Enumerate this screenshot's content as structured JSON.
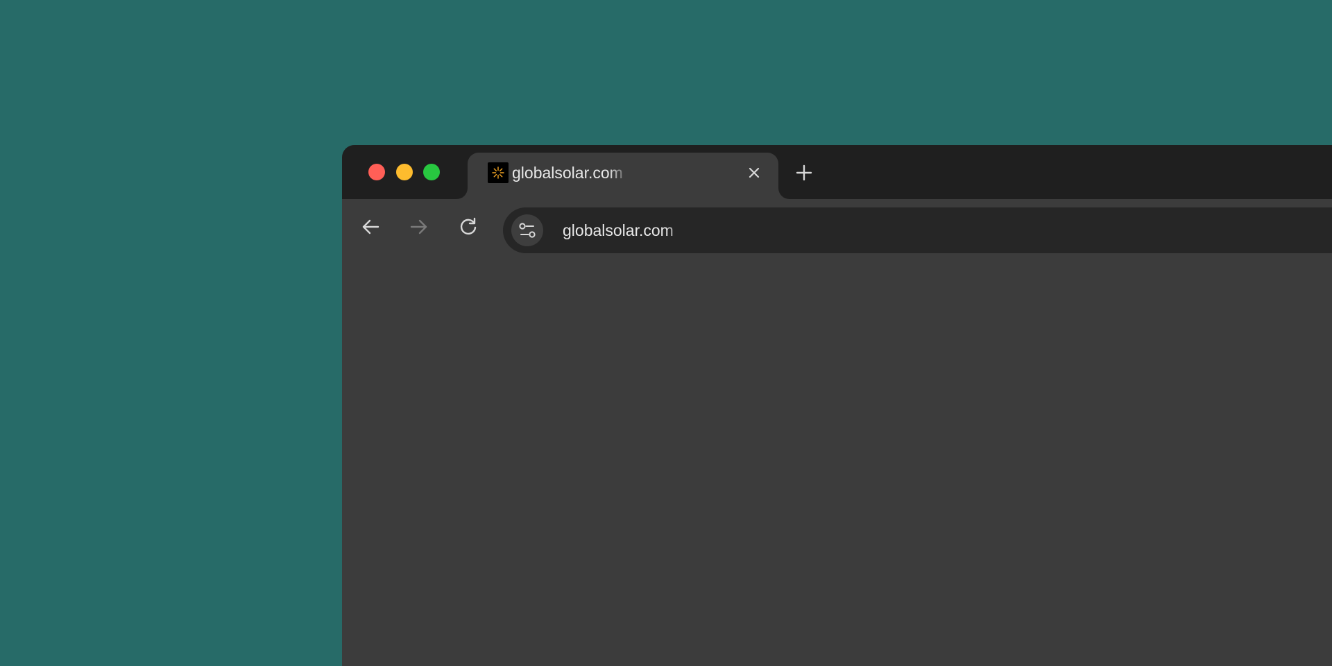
{
  "window": {
    "controls": [
      "close",
      "minimize",
      "maximize"
    ]
  },
  "tabs": [
    {
      "title": "globalsolar.com",
      "favicon": "sun-logo-icon",
      "active": true
    }
  ],
  "toolbar": {
    "back_icon": "arrow-left-icon",
    "forward_icon": "arrow-right-icon",
    "reload_icon": "reload-icon",
    "site_info_icon": "tune-icon"
  },
  "address_bar": {
    "value": "globalsolar.com"
  },
  "colors": {
    "desktop_background": "#276b68",
    "tabstrip": "#1f1f1f",
    "active_tab": "#3c3c3c",
    "omnibox": "#262626",
    "traffic_red": "#ff5f57",
    "traffic_yellow": "#febc2e",
    "traffic_green": "#28c840",
    "favicon_accent": "#f5a623"
  }
}
